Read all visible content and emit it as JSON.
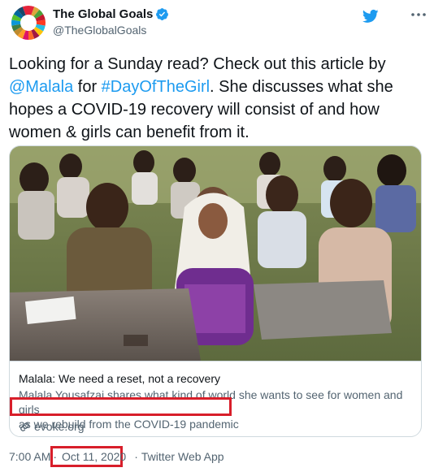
{
  "account": {
    "display_name": "The Global Goals",
    "handle": "@TheGlobalGoals",
    "avatar_icon": "sdg-color-wheel-icon",
    "verified_icon": "verified-badge-icon",
    "brand_color": "#1d9bf0"
  },
  "tweet": {
    "text_before_mention": "Looking for a Sunday read? Check out this article by ",
    "mention": "@Malala",
    "text_between": " for ",
    "hashtag": "#DayOfTheGirl",
    "text_after": ". She discusses what she hopes a COVID-19 recovery will consist of and how women & girls can benefit from it."
  },
  "card": {
    "image_icon": "classroom-photo",
    "title": "Malala: We need a reset, not a recovery",
    "description_line1": "Malala Yousafzai shares what kind of world she wants to see for women and girls",
    "description_line2": "as we rebuild from the COVID-19 pandemic",
    "domain": "evoke.org",
    "domain_icon": "link-icon"
  },
  "footer": {
    "time": "7:00 AM",
    "separator": "·",
    "date": "Oct 11, 2020",
    "source": "Twitter Web App"
  },
  "colors": {
    "highlight": "#d81e2a",
    "secondary_text": "#536471",
    "border": "#cfd9de"
  }
}
